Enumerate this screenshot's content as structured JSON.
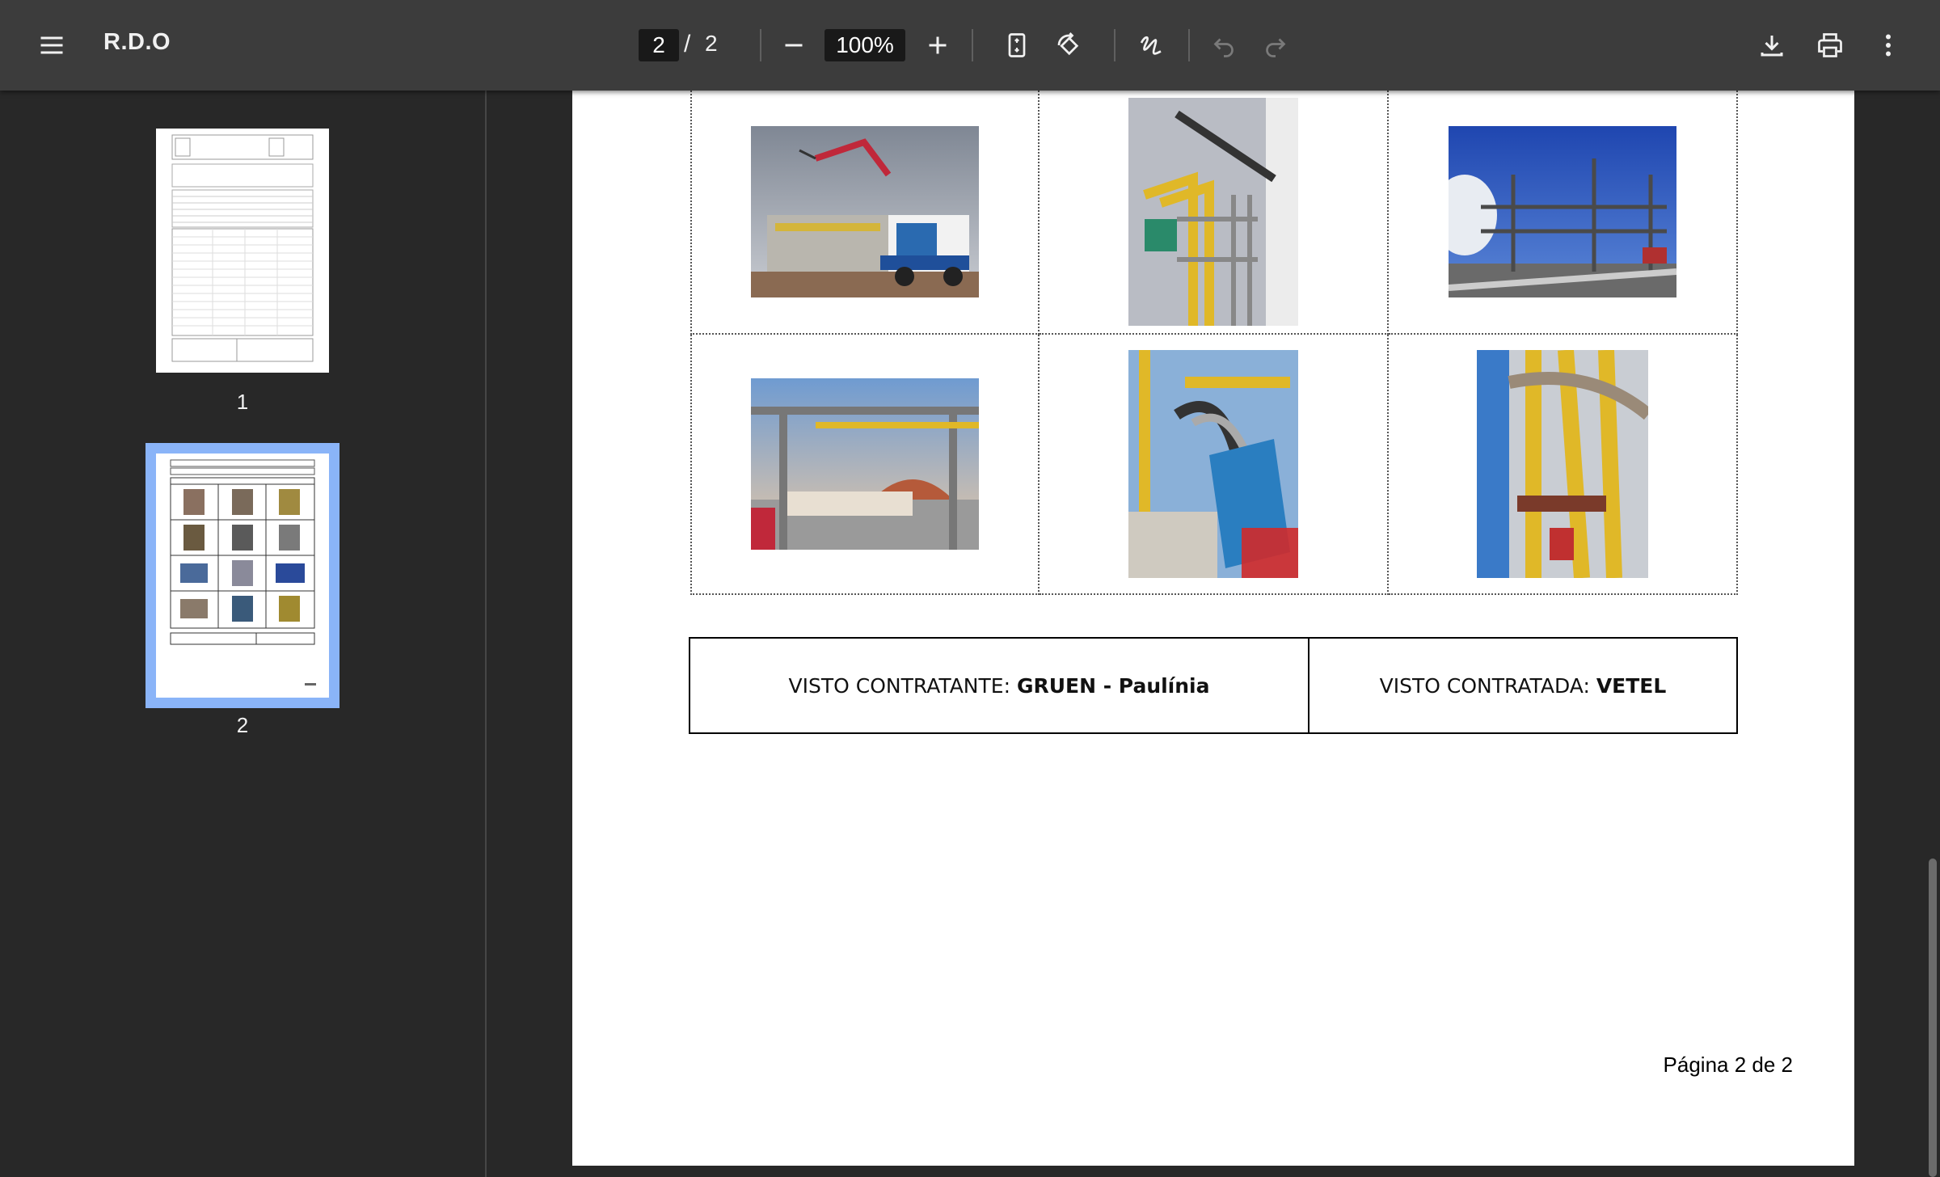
{
  "toolbar": {
    "title": "R.D.O",
    "current_page": "2",
    "separator": "/",
    "total_pages": "2",
    "zoom": "100%",
    "icons": [
      "menu-icon",
      "zoom-out-icon",
      "zoom-in-icon",
      "fit-page-icon",
      "rotate-icon",
      "draw-icon",
      "undo-icon",
      "redo-icon",
      "download-icon",
      "print-icon",
      "more-icon"
    ]
  },
  "sidebar": {
    "thumbnails": [
      {
        "label": "1",
        "selected": false
      },
      {
        "label": "2",
        "selected": true
      }
    ]
  },
  "document": {
    "visto_contratante_label": "VISTO CONTRATANTE: ",
    "visto_contratante_value": "GRUEN - Paulínia",
    "visto_contratada_label": "VISTO CONTRATADA: ",
    "visto_contratada_value": "VETEL",
    "footer": "Página 2 de 2"
  },
  "colors": {
    "toolbar_bg": "#3c3c3c",
    "viewer_bg": "#282828",
    "selected_thumb_border": "#8ab4f8"
  }
}
